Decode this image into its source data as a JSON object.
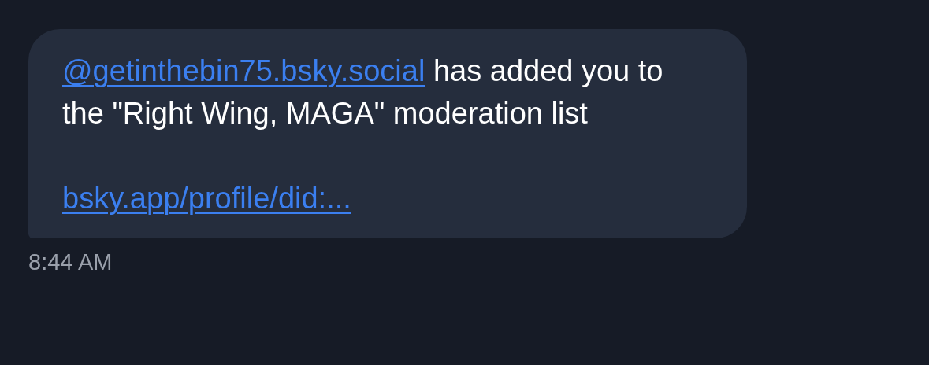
{
  "message": {
    "mention": "@getinthebin75.bsky.social",
    "text": "has added you to the \"Right Wing, MAGA\" moderation list",
    "link": "bsky.app/profile/did:..."
  },
  "timestamp": "8:44 AM"
}
